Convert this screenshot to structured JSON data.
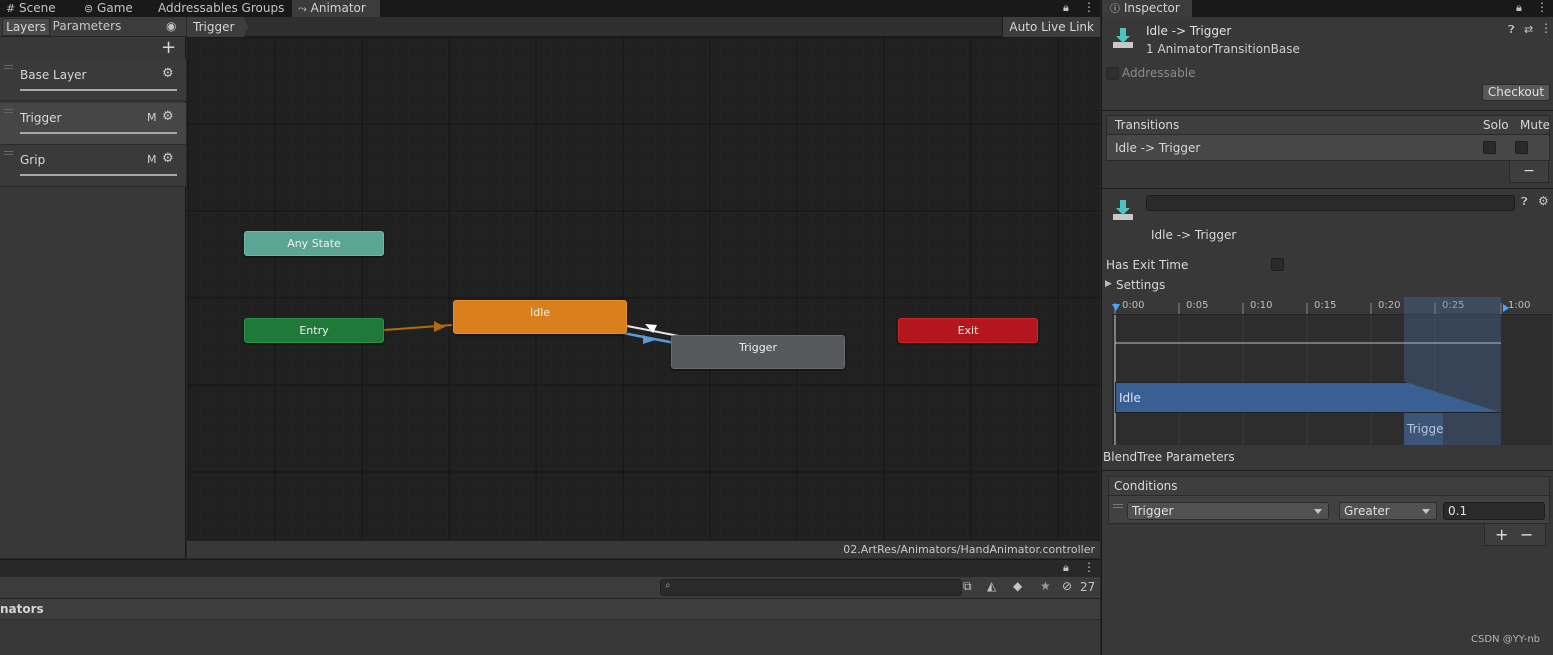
{
  "tabs": {
    "scene": "Scene",
    "game": "Game",
    "addressables": "Addressables Groups",
    "animator": "Animator",
    "inspector": "Inspector"
  },
  "animator": {
    "layers_tab": "Layers",
    "parameters_tab": "Parameters",
    "breadcrumb": "Trigger",
    "auto_live_link": "Auto Live Link",
    "layers": [
      {
        "name": "Base Layer",
        "badge": ""
      },
      {
        "name": "Trigger",
        "badge": "M"
      },
      {
        "name": "Grip",
        "badge": "M"
      }
    ],
    "nodes": {
      "any_state": "Any State",
      "entry": "Entry",
      "idle": "Idle",
      "trigger": "Trigger",
      "exit": "Exit"
    },
    "path": "02.ArtRes/Animators/HandAnimator.controller"
  },
  "bottom": {
    "title_fragment": "nators",
    "hidden_count": "27"
  },
  "inspector": {
    "title": "Idle -> Trigger",
    "subtitle": "1 AnimatorTransitionBase",
    "addressable": "Addressable",
    "checkout": "Checkout",
    "transitions_header": "Transitions",
    "solo": "Solo",
    "mute": "Mute",
    "transition_row": "Idle -> Trigger",
    "minus": "−",
    "transition_name_value": "",
    "transition_label": "Idle -> Trigger",
    "has_exit_time": "Has Exit Time",
    "settings": "Settings",
    "timeline_ticks": [
      "0:00",
      "0:05",
      "0:10",
      "0:15",
      "0:20",
      "0:25",
      "1:00"
    ],
    "clip_idle": "Idle",
    "clip_trigger": "Trigge",
    "blendtree": "BlendTree Parameters",
    "conditions": "Conditions",
    "condition_param": "Trigger",
    "condition_op": "Greater",
    "condition_value": "0.1",
    "plus": "+",
    "watermark": "CSDN @YY-nb"
  },
  "colors": {
    "any_state": "#5aa594",
    "entry": "#1f7a3a",
    "idle": "#d9801c",
    "trigger": "#56585c",
    "exit": "#b3161c",
    "selected_transition": "#5b9bd5"
  }
}
